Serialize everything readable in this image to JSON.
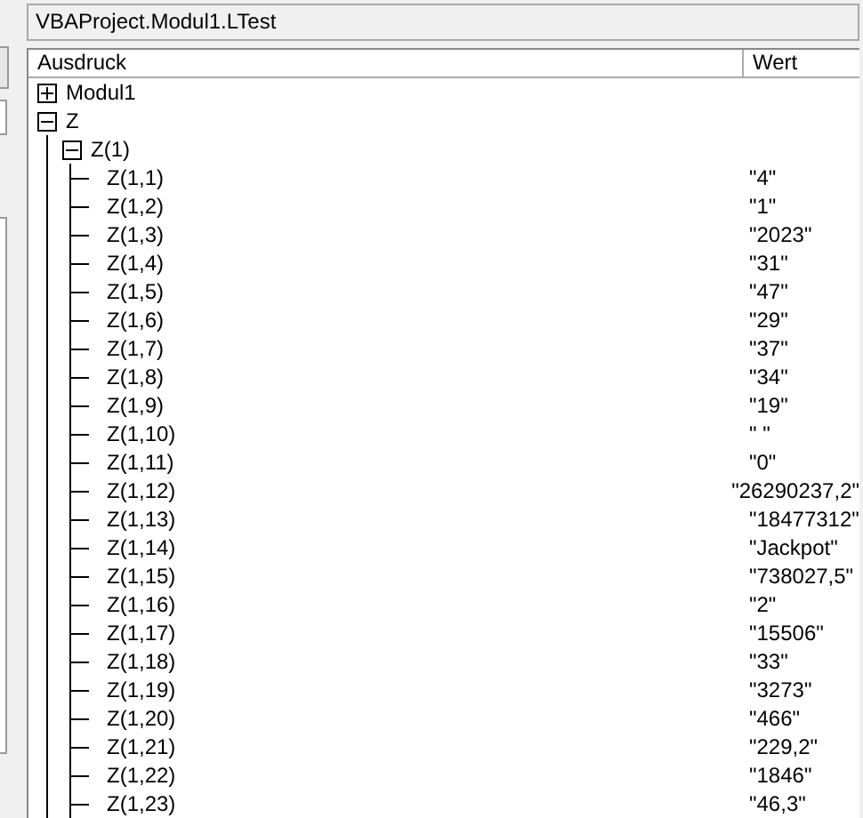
{
  "context": "VBAProject.Modul1.LTest",
  "columns": [
    "Ausdruck",
    "Wert"
  ],
  "tree": [
    {
      "expression": "Modul1",
      "expanded": false
    },
    {
      "expression": "Z",
      "expanded": true,
      "children": [
        {
          "expression": "Z(1)",
          "expanded": true,
          "children": [
            {
              "expression": "Z(1,1)",
              "value": "\"4\""
            },
            {
              "expression": "Z(1,2)",
              "value": "\"1\""
            },
            {
              "expression": "Z(1,3)",
              "value": "\"2023\""
            },
            {
              "expression": "Z(1,4)",
              "value": "\"31\""
            },
            {
              "expression": "Z(1,5)",
              "value": "\"47\""
            },
            {
              "expression": "Z(1,6)",
              "value": "\"29\""
            },
            {
              "expression": "Z(1,7)",
              "value": "\"37\""
            },
            {
              "expression": "Z(1,8)",
              "value": "\"34\""
            },
            {
              "expression": "Z(1,9)",
              "value": "\"19\""
            },
            {
              "expression": "Z(1,10)",
              "value": "\" \""
            },
            {
              "expression": "Z(1,11)",
              "value": "\"0\""
            },
            {
              "expression": "Z(1,12)",
              "value": "\"26290237,2\""
            },
            {
              "expression": "Z(1,13)",
              "value": "\"18477312\""
            },
            {
              "expression": "Z(1,14)",
              "value": "\"Jackpot\""
            },
            {
              "expression": "Z(1,15)",
              "value": "\"738027,5\""
            },
            {
              "expression": "Z(1,16)",
              "value": "\"2\""
            },
            {
              "expression": "Z(1,17)",
              "value": "\"15506\""
            },
            {
              "expression": "Z(1,18)",
              "value": "\"33\""
            },
            {
              "expression": "Z(1,19)",
              "value": "\"3273\""
            },
            {
              "expression": "Z(1,20)",
              "value": "\"466\""
            },
            {
              "expression": "Z(1,21)",
              "value": "\"229,2\""
            },
            {
              "expression": "Z(1,22)",
              "value": "\"1846\""
            },
            {
              "expression": "Z(1,23)",
              "value": "\"46,3\""
            }
          ]
        }
      ]
    }
  ]
}
